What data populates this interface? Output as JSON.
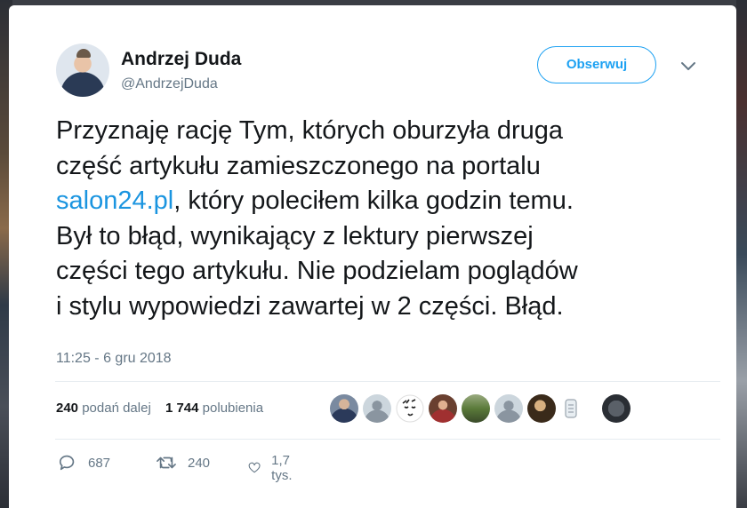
{
  "author": {
    "name": "Andrzej Duda",
    "handle": "@AndrzejDuda"
  },
  "follow_button": "Obserwuj",
  "tweet": {
    "line1": "Przyznaję rację Tym, których oburzyła druga",
    "line2": "część artykułu zamieszczonego na portalu",
    "link": "salon24.pl",
    "line3_rest": ", który poleciłem kilka godzin temu.",
    "line4": "Był to błąd, wynikający z lektury pierwszej",
    "line5": "części tego artykułu. Nie podzielam poglądów",
    "line6": "i stylu wypowiedzi zawartej w 2 części. Błąd."
  },
  "timestamp": "11:25 - 6 gru 2018",
  "stats": {
    "retweets_count": "240",
    "retweets_label": "podań dalej",
    "likes_count": "1 744",
    "likes_label": "polubienia"
  },
  "actions": {
    "replies": "687",
    "retweets": "240",
    "likes": "1,7 tys."
  },
  "colors": {
    "accent": "#1da1f2",
    "link": "#1b95e0",
    "text": "#14171a",
    "secondary": "#657786"
  }
}
